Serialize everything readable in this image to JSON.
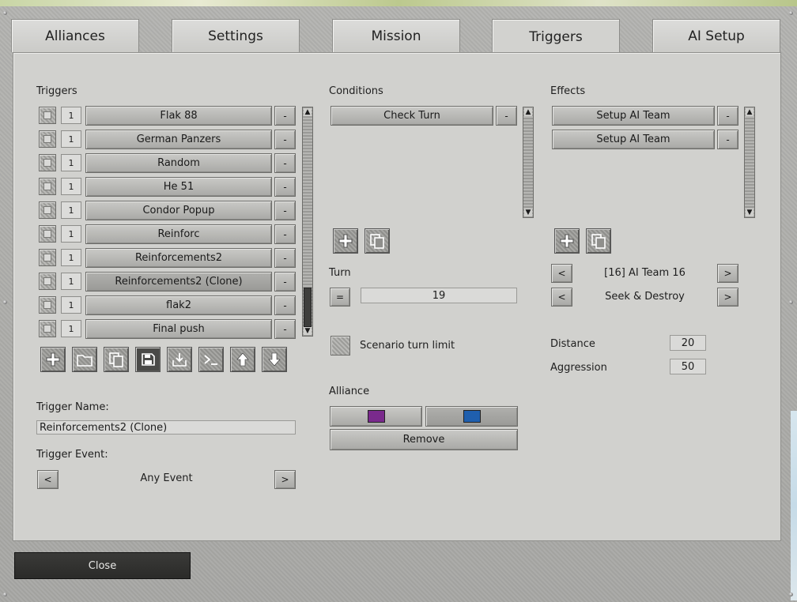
{
  "tabs": [
    {
      "label": "Alliances"
    },
    {
      "label": "Settings"
    },
    {
      "label": "Mission"
    },
    {
      "label": "Triggers",
      "active": true
    },
    {
      "label": "AI Setup"
    }
  ],
  "triggers": {
    "heading": "Triggers",
    "items": [
      {
        "count": "1",
        "name": "Flak 88",
        "remove": "-"
      },
      {
        "count": "1",
        "name": "German Panzers",
        "remove": "-"
      },
      {
        "count": "1",
        "name": "Random",
        "remove": "-"
      },
      {
        "count": "1",
        "name": "He 51",
        "remove": "-"
      },
      {
        "count": "1",
        "name": "Condor Popup",
        "remove": "-"
      },
      {
        "count": "1",
        "name": "Reinforc",
        "remove": "-"
      },
      {
        "count": "1",
        "name": "Reinforcements2",
        "remove": "-"
      },
      {
        "count": "1",
        "name": "Reinforcements2 (Clone)",
        "remove": "-",
        "selected": true
      },
      {
        "count": "1",
        "name": "flak2",
        "remove": "-"
      },
      {
        "count": "1",
        "name": "Final push",
        "remove": "-"
      }
    ],
    "toolbar_icons": [
      "plus-icon",
      "folder-icon",
      "copy-icon",
      "save-icon",
      "import-icon",
      "console-icon",
      "arrow-up-icon",
      "arrow-down-icon"
    ],
    "name_label": "Trigger Name:",
    "name_value": "Reinforcements2 (Clone)",
    "event_label": "Trigger Event:",
    "event_value": "Any Event",
    "prev": "<",
    "next": ">"
  },
  "conditions": {
    "heading": "Conditions",
    "items": [
      {
        "name": "Check Turn",
        "remove": "-"
      }
    ],
    "turn_label": "Turn",
    "turn_operator": "=",
    "turn_value": "19",
    "scenario_limit_label": "Scenario turn limit",
    "alliance_label": "Alliance",
    "alliance_colors": [
      "#7a2a8c",
      "#1f5fae"
    ],
    "remove_label": "Remove"
  },
  "effects": {
    "heading": "Effects",
    "items": [
      {
        "name": "Setup AI Team",
        "remove": "-"
      },
      {
        "name": "Setup AI Team",
        "remove": "-"
      }
    ],
    "team_value": "[16] AI Team 16",
    "mode_value": "Seek & Destroy",
    "prev": "<",
    "next": ">",
    "distance_label": "Distance",
    "distance_value": "20",
    "aggression_label": "Aggression",
    "aggression_value": "50"
  },
  "footer": {
    "close_label": "Close"
  }
}
